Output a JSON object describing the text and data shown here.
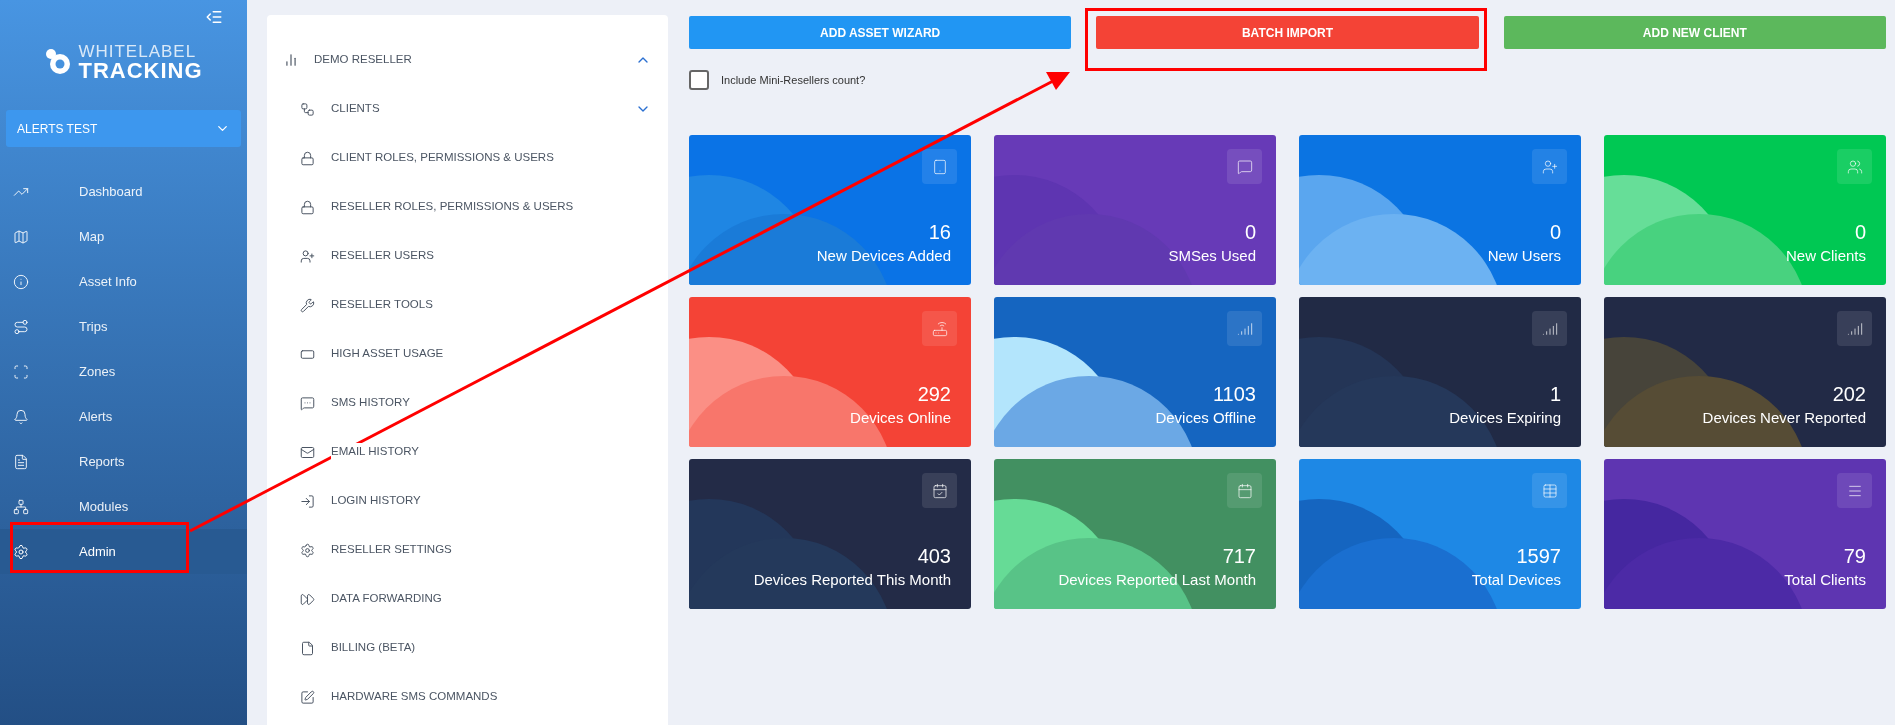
{
  "sidebar": {
    "logo": {
      "line1": "WHITELABEL",
      "line2": "TRACKING"
    },
    "account_select": {
      "value": "ALERTS TEST"
    },
    "items": [
      {
        "label": "Dashboard",
        "selected": false
      },
      {
        "label": "Map",
        "selected": false
      },
      {
        "label": "Asset Info",
        "selected": false
      },
      {
        "label": "Trips",
        "selected": false
      },
      {
        "label": "Zones",
        "selected": false
      },
      {
        "label": "Alerts",
        "selected": false
      },
      {
        "label": "Reports",
        "selected": false
      },
      {
        "label": "Modules",
        "selected": false
      },
      {
        "label": "Admin",
        "selected": true
      }
    ]
  },
  "admin_menu": {
    "title": "DEMO RESELLER",
    "expanded": true,
    "children": [
      {
        "label": "CLIENTS",
        "kind": "group",
        "expanded": false
      },
      {
        "label": "CLIENT ROLES, PERMISSIONS & USERS",
        "kind": "link"
      },
      {
        "label": "RESELLER ROLES, PERMISSIONS & USERS",
        "kind": "link"
      },
      {
        "label": "RESELLER USERS",
        "kind": "link"
      },
      {
        "label": "RESELLER TOOLS",
        "kind": "link"
      },
      {
        "label": "HIGH ASSET USAGE",
        "kind": "link"
      },
      {
        "label": "SMS HISTORY",
        "kind": "link"
      },
      {
        "label": "EMAIL HISTORY",
        "kind": "link"
      },
      {
        "label": "LOGIN HISTORY",
        "kind": "link"
      },
      {
        "label": "RESELLER SETTINGS",
        "kind": "link"
      },
      {
        "label": "DATA FORWARDING",
        "kind": "link"
      },
      {
        "label": "BILLING (BETA)",
        "kind": "link"
      },
      {
        "label": "HARDWARE SMS COMMANDS",
        "kind": "link"
      }
    ]
  },
  "actions": [
    {
      "label": "ADD ASSET WIZARD",
      "color": "#2196f3"
    },
    {
      "label": "BATCH IMPORT",
      "color": "#f44336"
    },
    {
      "label": "ADD NEW CLIENT",
      "color": "#5cb85c"
    }
  ],
  "include_mini_resellers": {
    "label": "Include Mini-Resellers count?",
    "checked": false
  },
  "cards": [
    {
      "value": "16",
      "label": "New Devices Added",
      "color": "#0a73e6"
    },
    {
      "value": "0",
      "label": "SMSes Used",
      "color": "#673ab7"
    },
    {
      "value": "0",
      "label": "New Users",
      "color": "#0b74e2"
    },
    {
      "value": "0",
      "label": "New Clients",
      "color": "#00c853"
    },
    {
      "value": "292",
      "label": "Devices Online",
      "color": "#f44336"
    },
    {
      "value": "1103",
      "label": "Devices Offline",
      "color": "#1565c0"
    },
    {
      "value": "1",
      "label": "Devices Expiring",
      "color": "#212a45"
    },
    {
      "value": "202",
      "label": "Devices Never Reported",
      "color": "#222a46"
    },
    {
      "value": "403",
      "label": "Devices Reported This Month",
      "color": "#232b47"
    },
    {
      "value": "717",
      "label": "Devices Reported Last Month",
      "color": "#429061"
    },
    {
      "value": "1597",
      "label": "Total Devices",
      "color": "#1e88e5"
    },
    {
      "value": "79",
      "label": "Total Clients",
      "color": "#5e35b1"
    }
  ]
}
